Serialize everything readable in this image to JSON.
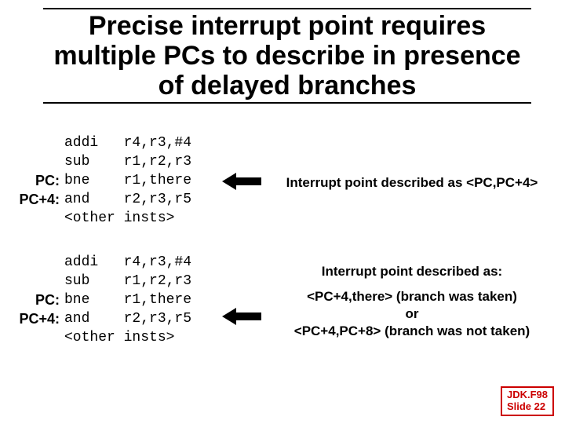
{
  "title": "Precise interrupt point requires multiple PCs to describe in presence of delayed branches",
  "pc_labels": {
    "pc": "PC:",
    "pc4": "PC+4:"
  },
  "code_block": "addi   r4,r3,#4\nsub    r1,r2,r3\nbne    r1,there\nand    r2,r3,r5\n<other insts>",
  "desc1": "Interrupt point described as <PC,PC+4>",
  "desc2_a": "Interrupt point described as:",
  "desc2_b": "<PC+4,there> (branch was taken)",
  "desc2_c": "or",
  "desc2_d": "<PC+4,PC+8> (branch was not taken)",
  "footer1": "JDK.F98",
  "footer2": "Slide 22",
  "colors": {
    "accent": "#c00"
  }
}
